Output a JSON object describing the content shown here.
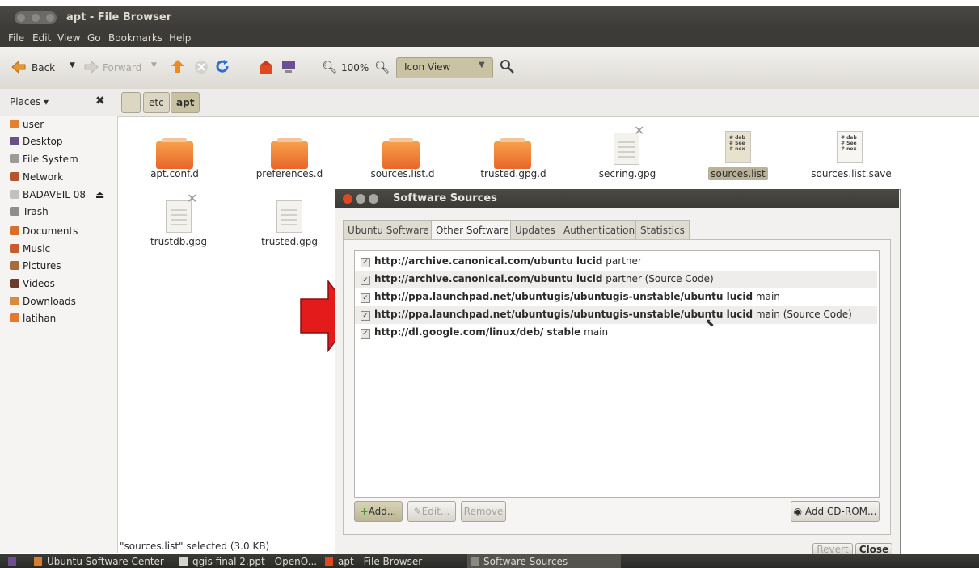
{
  "window": {
    "title": "apt - File Browser"
  },
  "menu": [
    "File",
    "Edit",
    "View",
    "Go",
    "Bookmarks",
    "Help"
  ],
  "toolbar": {
    "back": "Back",
    "forward": "Forward",
    "zoom": "100%",
    "view_mode": "Icon View"
  },
  "places": {
    "label": "Places ▾",
    "close": "✖"
  },
  "breadcrumb": [
    "etc",
    "apt"
  ],
  "sidebar": [
    {
      "label": "user",
      "icon": "home-folder-icon",
      "color": "#e2802f"
    },
    {
      "label": "Desktop",
      "icon": "desktop-icon",
      "color": "#6a4f8f"
    },
    {
      "label": "File System",
      "icon": "hard-disk-icon",
      "color": "#9c9b97"
    },
    {
      "label": "Network",
      "icon": "network-icon",
      "color": "#b6542f"
    },
    {
      "label": "BADAVEIL 08",
      "icon": "usb-drive-icon",
      "color": "#c3c1bc"
    },
    {
      "label": "Trash",
      "icon": "trash-icon",
      "color": "#8f8e8a"
    },
    {
      "label": "Documents",
      "icon": "documents-folder-icon",
      "color": "#d6702c"
    },
    {
      "label": "Music",
      "icon": "music-folder-icon",
      "color": "#c75d2b"
    },
    {
      "label": "Pictures",
      "icon": "pictures-folder-icon",
      "color": "#a46d3b"
    },
    {
      "label": "Videos",
      "icon": "videos-folder-icon",
      "color": "#6a3d2b"
    },
    {
      "label": "Downloads",
      "icon": "downloads-folder-icon",
      "color": "#d98a3a"
    },
    {
      "label": "latihan",
      "icon": "folder-icon",
      "color": "#e9772d"
    }
  ],
  "files": [
    {
      "name": "apt.conf.d",
      "type": "folder"
    },
    {
      "name": "preferences.d",
      "type": "folder"
    },
    {
      "name": "sources.list.d",
      "type": "folder"
    },
    {
      "name": "trusted.gpg.d",
      "type": "folder"
    },
    {
      "name": "secring.gpg",
      "type": "file-unreadable"
    },
    {
      "name": "sources.list",
      "type": "text",
      "selected": true
    },
    {
      "name": "sources.list.save",
      "type": "text"
    },
    {
      "name": "trustdb.gpg",
      "type": "file-unreadable"
    },
    {
      "name": "trusted.gpg",
      "type": "file"
    }
  ],
  "status": "\"sources.list\" selected (3.0 KB)",
  "dialog": {
    "title": "Software Sources",
    "tabs": [
      "Ubuntu Software",
      "Other Software",
      "Updates",
      "Authentication",
      "Statistics"
    ],
    "active_tab": "Other Software",
    "sources": [
      {
        "url": "http://archive.canonical.com/ubuntu lucid",
        "suffix": "partner",
        "checked": true
      },
      {
        "url": "http://archive.canonical.com/ubuntu lucid",
        "suffix": "partner (Source Code)",
        "checked": true
      },
      {
        "url": "http://ppa.launchpad.net/ubuntugis/ubuntugis-unstable/ubuntu lucid",
        "suffix": "main",
        "checked": true
      },
      {
        "url": "http://ppa.launchpad.net/ubuntugis/ubuntugis-unstable/ubuntu lucid",
        "suffix": "main (Source Code)",
        "checked": true
      },
      {
        "url": "http://dl.google.com/linux/deb/ stable",
        "suffix": "main",
        "checked": true
      }
    ],
    "buttons": {
      "add": "Add...",
      "edit": "Edit...",
      "remove": "Remove",
      "add_cdrom": "Add CD-ROM...",
      "revert": "Revert",
      "close": "Close"
    }
  },
  "taskbar": [
    {
      "label": "Ubuntu Software Center"
    },
    {
      "label": "qgis final 2.ppt - OpenO..."
    },
    {
      "label": "apt - File Browser"
    },
    {
      "label": "Software Sources"
    }
  ],
  "colors": {
    "accent": "#e0491f",
    "arrow": "#e31b1b"
  }
}
